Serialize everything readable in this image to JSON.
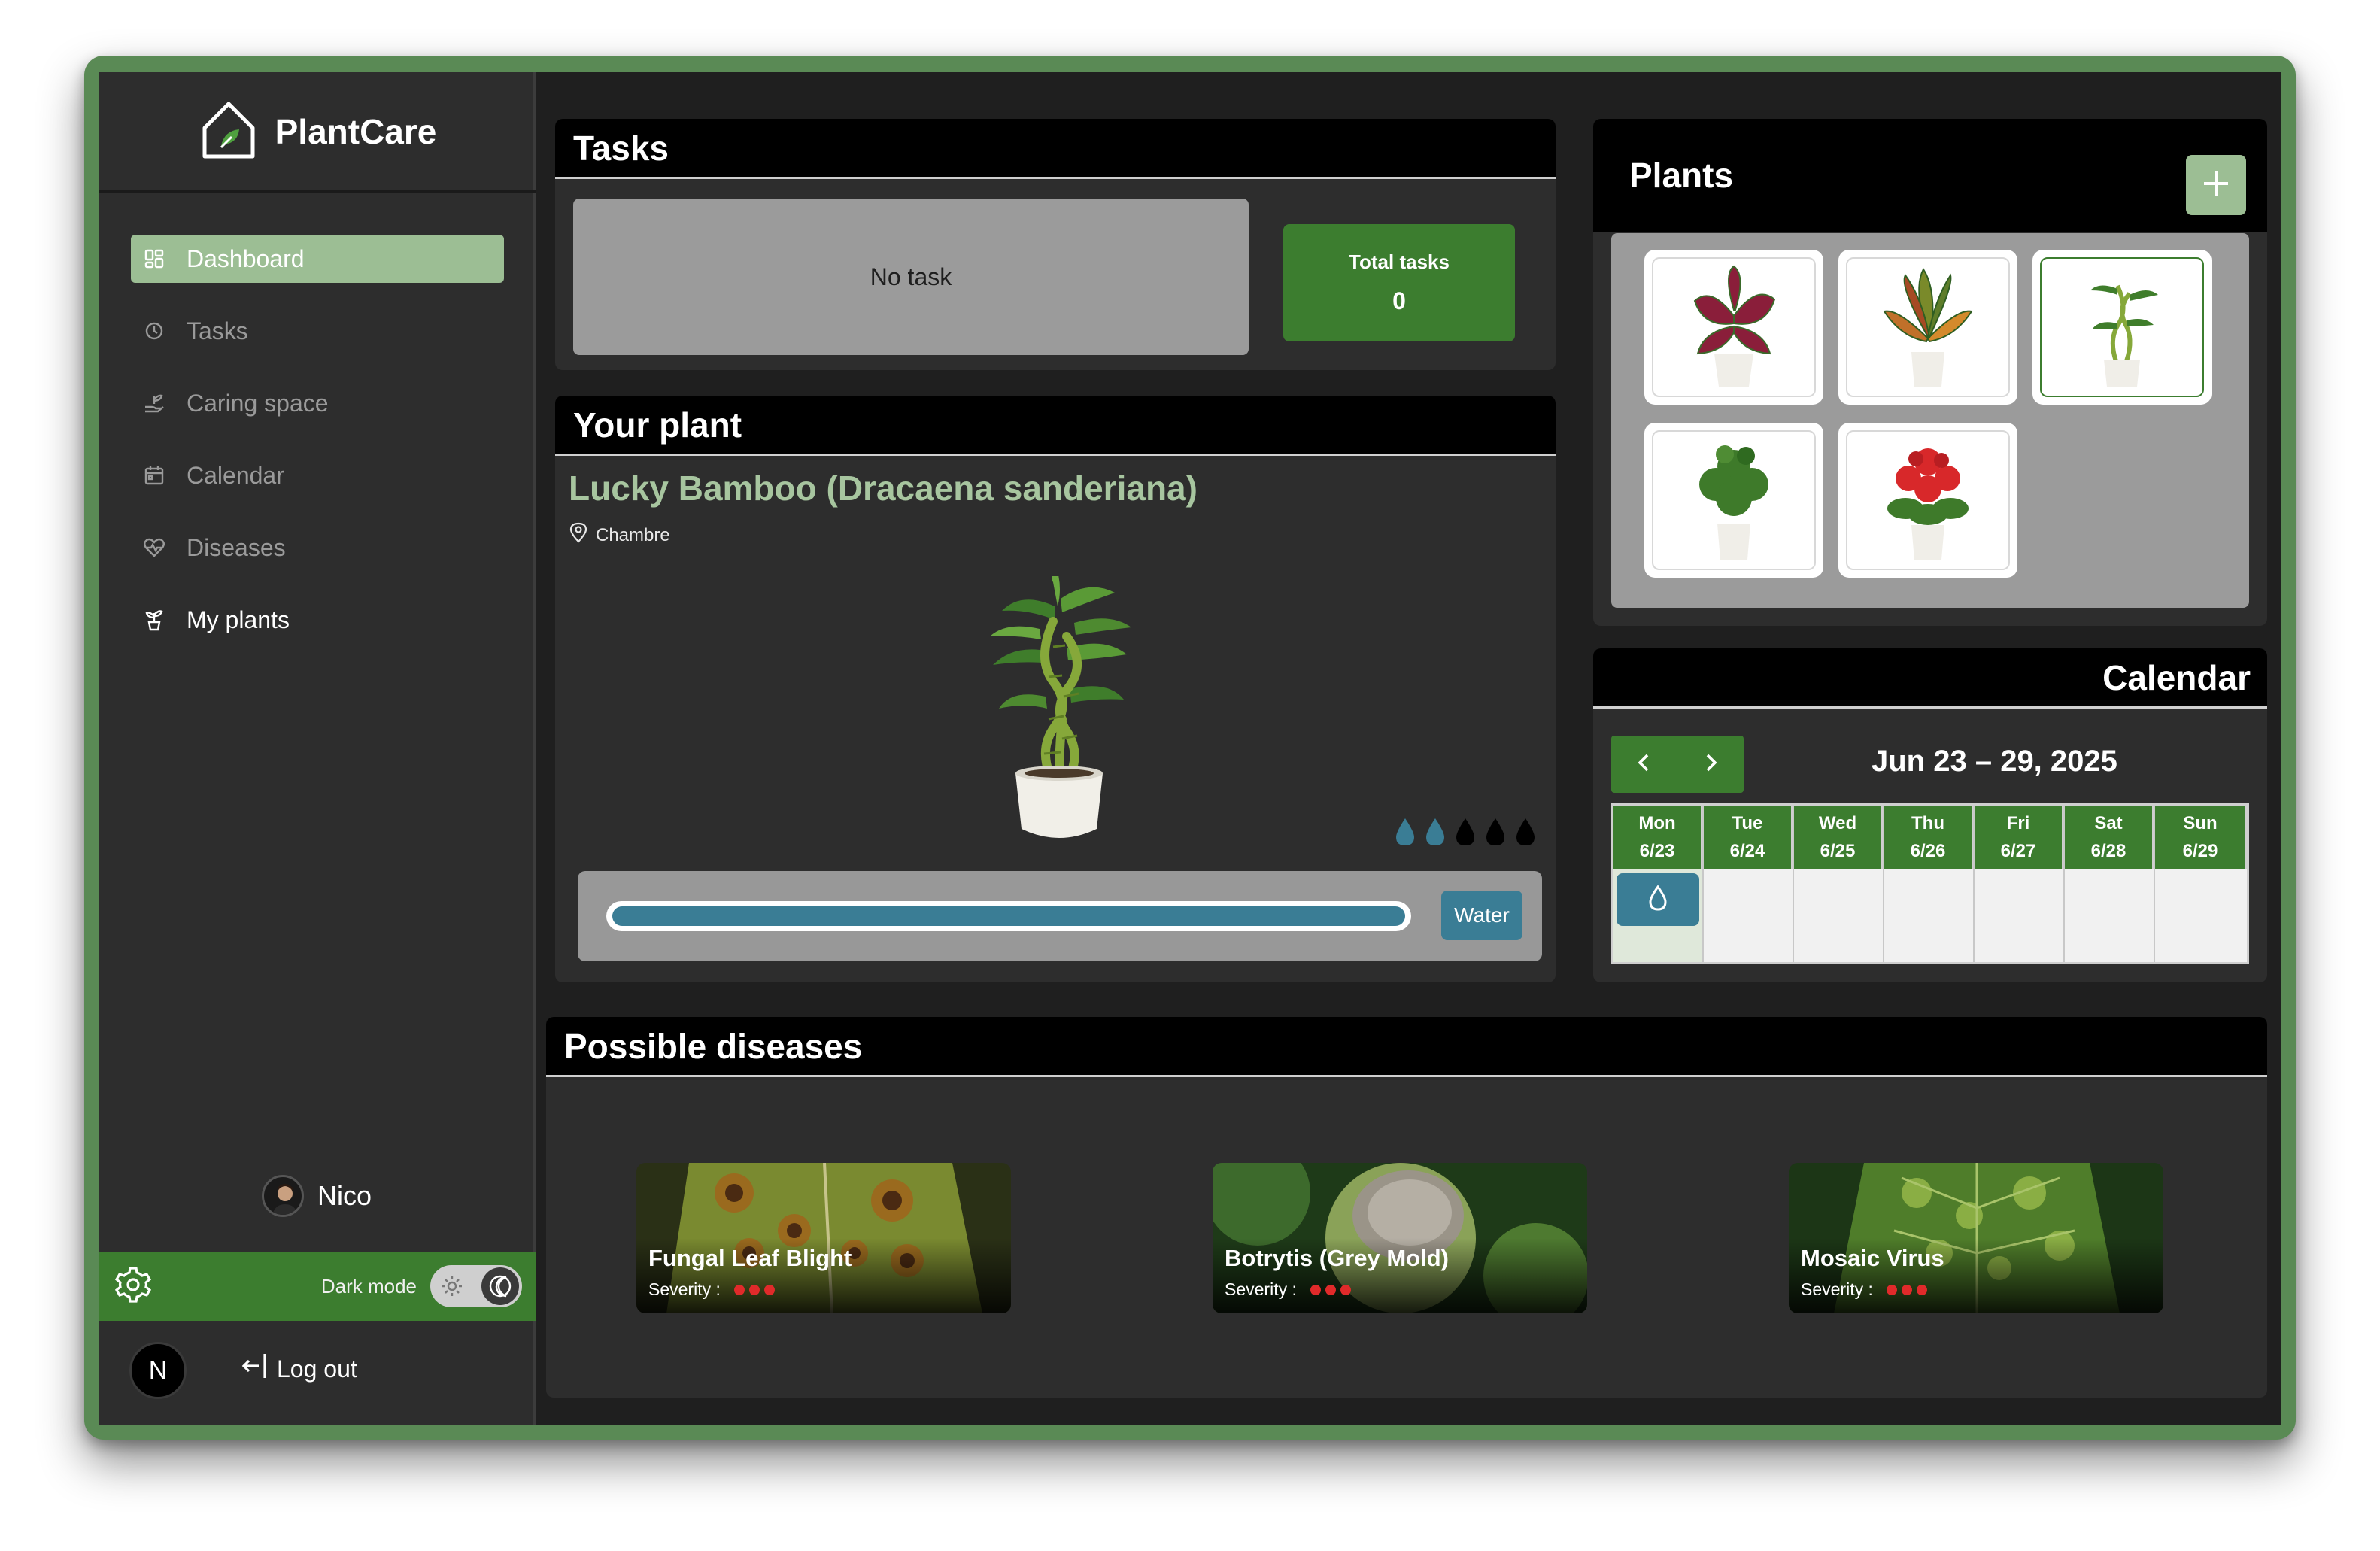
{
  "app": {
    "title": "PlantCare"
  },
  "sidebar": {
    "items": [
      {
        "label": "Dashboard",
        "icon": "dashboard-icon",
        "active": true
      },
      {
        "label": "Tasks",
        "icon": "clock-icon"
      },
      {
        "label": "Caring space",
        "icon": "hand-plant-icon"
      },
      {
        "label": "Calendar",
        "icon": "calendar-icon"
      },
      {
        "label": "Diseases",
        "icon": "heart-pulse-icon"
      },
      {
        "label": "My plants",
        "icon": "potted-plant-icon"
      }
    ],
    "user_name": "Nico",
    "dark_mode_label": "Dark mode",
    "logout_label": "Log out",
    "badge_letter": "N"
  },
  "tasks": {
    "title": "Tasks",
    "empty_text": "No task",
    "total_label": "Total tasks",
    "total_value": "0"
  },
  "your_plant": {
    "title": "Your plant",
    "name": "Lucky Bamboo (Dracaena sanderiana)",
    "location": "Chambre",
    "water_drops_filled": 2,
    "water_drops_total": 5,
    "water_level": 1.0,
    "water_button": "Water"
  },
  "plants": {
    "title": "Plants",
    "items": [
      "Coleus",
      "Croton",
      "Lucky Bamboo",
      "Herb shrub",
      "Red Geranium"
    ],
    "selected_index": 2
  },
  "calendar": {
    "title": "Calendar",
    "range": "Jun 23 – 29, 2025",
    "days": [
      {
        "day": "Mon",
        "date": "6/23"
      },
      {
        "day": "Tue",
        "date": "6/24"
      },
      {
        "day": "Wed",
        "date": "6/25"
      },
      {
        "day": "Thu",
        "date": "6/26"
      },
      {
        "day": "Fri",
        "date": "6/27"
      },
      {
        "day": "Sat",
        "date": "6/28"
      },
      {
        "day": "Sun",
        "date": "6/29"
      }
    ]
  },
  "diseases": {
    "title": "Possible diseases",
    "severity_label": "Severity :",
    "items": [
      {
        "name": "Fungal Leaf Blight",
        "severity": 3
      },
      {
        "name": "Botrytis (Grey Mold)",
        "severity": 3
      },
      {
        "name": "Mosaic Virus",
        "severity": 3
      }
    ]
  },
  "colors": {
    "accent_green": "#3c7d2f",
    "soft_green": "#9cbe94",
    "water_blue": "#3a7d95",
    "severity_red": "#e02a2a"
  }
}
